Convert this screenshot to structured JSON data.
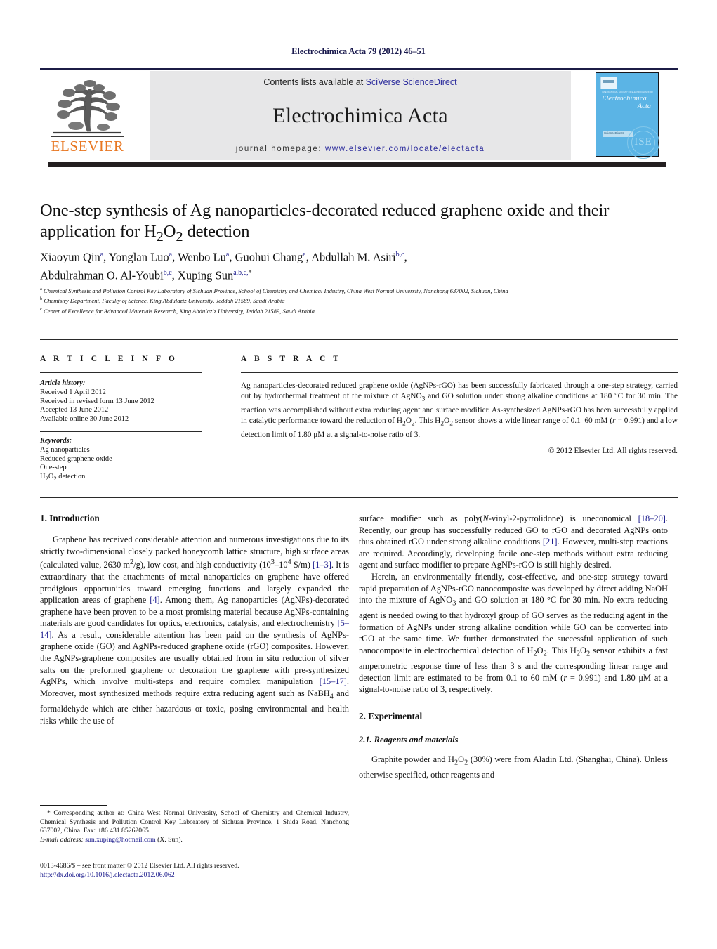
{
  "running_head": "Electrochimica Acta 79 (2012) 46–51",
  "header": {
    "contents_prefix": "Contents lists available at ",
    "contents_link": "SciVerse ScienceDirect",
    "journal_title": "Electrochimica Acta",
    "homepage_prefix": "journal homepage: ",
    "homepage_link": "www.elsevier.com/locate/electacta",
    "publisher_logo_text": "ELSEVIER",
    "cover": {
      "tiny_line": "INTERNATIONAL SOCIETY OF ELECTROCHEMISTRY",
      "name_line1": "Electrochimica",
      "name_line2": "Acta",
      "sciencedirect_label": "ScienceDirect",
      "seal_text": "ISE"
    },
    "accent_color": "#2a2a9c",
    "logo_color": "#e87722",
    "band_color": "#231f20",
    "grey_color": "#e7e7e8"
  },
  "article": {
    "title": "One-step synthesis of Ag nanoparticles-decorated reduced graphene oxide and their application for H2O2 detection",
    "authors_line1_parts": [
      {
        "name": "Xiaoyun Qin",
        "sup": "a"
      },
      {
        "name": "Yonglan Luo",
        "sup": "a"
      },
      {
        "name": "Wenbo Lu",
        "sup": "a"
      },
      {
        "name": "Guohui Chang",
        "sup": "a"
      },
      {
        "name": "Abdullah M. Asiri",
        "sup": "b,c"
      }
    ],
    "authors_line2_parts": [
      {
        "name": "Abdulrahman O. Al-Youbi",
        "sup": "b,c"
      },
      {
        "name": "Xuping Sun",
        "sup": "a,b,c,*"
      }
    ],
    "affiliations": [
      {
        "mark": "a",
        "text": "Chemical Synthesis and Pollution Control Key Laboratory of Sichuan Province, School of Chemistry and Chemical Industry, China West Normal University, Nanchong 637002, Sichuan, China"
      },
      {
        "mark": "b",
        "text": "Chemistry Department, Faculty of Science, King Abdulaziz University, Jeddah 21589, Saudi Arabia"
      },
      {
        "mark": "c",
        "text": "Center of Excellence for Advanced Materials Research, King Abdulaziz University, Jeddah 21589, Saudi Arabia"
      }
    ]
  },
  "article_info": {
    "heading": "A R T I C L E   I N F O",
    "history_label": "Article history:",
    "history": [
      "Received 1 April 2012",
      "Received in revised form 13 June 2012",
      "Accepted 13 June 2012",
      "Available online 30 June 2012"
    ],
    "keywords_label": "Keywords:",
    "keywords": [
      "Ag nanoparticles",
      "Reduced graphene oxide",
      "One-step",
      "H2O2 detection"
    ]
  },
  "abstract": {
    "heading": "A B S T R A C T",
    "text": "Ag nanoparticles-decorated reduced graphene oxide (AgNPs-rGO) has been successfully fabricated through a one-step strategy, carried out by hydrothermal treatment of the mixture of AgNO3 and GO solution under strong alkaline conditions at 180 °C for 30 min. The reaction was accomplished without extra reducing agent and surface modifier. As-synthesized AgNPs-rGO has been successfully applied in catalytic performance toward the reduction of H2O2. This H2O2 sensor shows a wide linear range of 0.1–60 mM (r = 0.991) and a low detection limit of 1.80 μM at a signal-to-noise ratio of 3.",
    "copyright": "© 2012 Elsevier Ltd. All rights reserved."
  },
  "body": {
    "section1_heading": "1.  Introduction",
    "intro_p1": "Graphene has received considerable attention and numerous investigations due to its strictly two-dimensional closely packed honeycomb lattice structure, high surface areas (calculated value, 2630 m2/g), low cost, and high conductivity (103–104 S/m) [1–3]. It is extraordinary that the attachments of metal nanoparticles on graphene have offered prodigious opportunities toward emerging functions and largely expanded the application areas of graphene [4]. Among them, Ag nanoparticles (AgNPs)-decorated graphene have been proven to be a most promising material because AgNPs-containing materials are good candidates for optics, electronics, catalysis, and electrochemistry [5–14]. As a result, considerable attention has been paid on the synthesis of AgNPs-graphene oxide (GO) and AgNPs-reduced graphene oxide (rGO) composites. However, the AgNPs-graphene composites are usually obtained from in situ reduction of silver salts on the preformed graphene or decoration the graphene with pre-synthesized AgNPs, which involve multi-steps and require complex manipulation [15–17]. Moreover, most synthesized methods require extra reducing agent such as NaBH4 and formaldehyde which are either hazardous or toxic, posing environmental and health risks while the use of",
    "intro_p1_cont": "surface modifier such as poly(N-vinyl-2-pyrrolidone) is uneconomical [18–20]. Recently, our group has successfully reduced GO to rGO and decorated AgNPs onto thus obtained rGO under strong alkaline conditions [21]. However, multi-step reactions are required. Accordingly, developing facile one-step methods without extra reducing agent and surface modifier to prepare AgNPs-rGO is still highly desired.",
    "intro_p2": "Herein, an environmentally friendly, cost-effective, and one-step strategy toward rapid preparation of AgNPs-rGO nanocomposite was developed by direct adding NaOH into the mixture of AgNO3 and GO solution at 180 °C for 30 min. No extra reducing agent is needed owing to that hydroxyl group of GO serves as the reducing agent in the formation of AgNPs under strong alkaline condition while GO can be converted into rGO at the same time. We further demonstrated the successful application of such nanocomposite in electrochemical detection of H2O2. This H2O2 sensor exhibits a fast amperometric response time of less than 3 s and the corresponding linear range and detection limit are estimated to be from 0.1 to 60 mM (r = 0.991) and 1.80 μM at a signal-to-noise ratio of 3, respectively.",
    "section2_heading": "2.  Experimental",
    "subsection21_heading": "2.1.  Reagents and materials",
    "exp_p1": "Graphite powder and H2O2 (30%) were from Aladin Ltd. (Shanghai, China). Unless otherwise specified, other reagents and"
  },
  "footnote": {
    "star": "*",
    "text": "Corresponding author at: China West Normal University, School of Chemistry and Chemical Industry, Chemical Synthesis and Pollution Control Key Laboratory of Sichuan Province, 1 Shida Road, Nanchong 637002, China. Fax: +86 431 85262065.",
    "email_label": "E-mail address:",
    "email": "sun.xuping@hotmail.com",
    "email_suffix": " (X. Sun)."
  },
  "footer": {
    "issn_line": "0013-4686/$ – see front matter © 2012 Elsevier Ltd. All rights reserved.",
    "doi": "http://dx.doi.org/10.1016/j.electacta.2012.06.062"
  }
}
